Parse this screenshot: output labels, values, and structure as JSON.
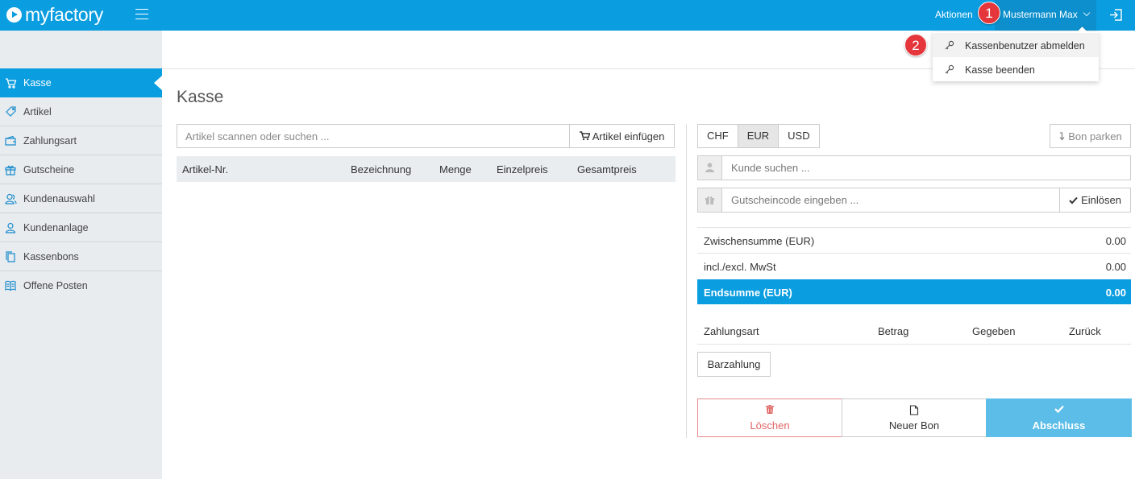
{
  "header": {
    "logo_text": "myfactory",
    "actions_label": "Aktionen",
    "user_name": "Mustermann Max"
  },
  "callouts": [
    "1",
    "2"
  ],
  "user_menu": {
    "items": [
      {
        "label": "Kassenbenutzer abmelden",
        "icon": "key-icon"
      },
      {
        "label": "Kasse beenden",
        "icon": "key-icon"
      }
    ]
  },
  "sidebar": {
    "items": [
      {
        "label": "Kasse",
        "icon": "cart-icon",
        "active": true
      },
      {
        "label": "Artikel",
        "icon": "tag-icon"
      },
      {
        "label": "Zahlungsart",
        "icon": "wallet-icon"
      },
      {
        "label": "Gutscheine",
        "icon": "gift-icon"
      },
      {
        "label": "Kundenauswahl",
        "icon": "users-icon"
      },
      {
        "label": "Kundenanlage",
        "icon": "user-icon"
      },
      {
        "label": "Kassenbons",
        "icon": "copy-icon"
      },
      {
        "label": "Offene Posten",
        "icon": "book-icon"
      }
    ]
  },
  "main": {
    "title": "Kasse",
    "search_placeholder": "Artikel scannen oder suchen ...",
    "insert_button": "Artikel einfügen",
    "columns": [
      "Artikel-Nr.",
      "Bezeichnung",
      "Menge",
      "Einzelpreis",
      "Gesamtpreis"
    ]
  },
  "cart": {
    "currencies": [
      "CHF",
      "EUR",
      "USD"
    ],
    "active_currency": "EUR",
    "park_button": "Bon parken",
    "customer_placeholder": "Kunde suchen ...",
    "voucher_placeholder": "Gutscheincode eingeben ...",
    "redeem_button": "Einlösen",
    "subtotal_label": "Zwischensumme (EUR)",
    "subtotal_value": "0.00",
    "tax_label": "incl./excl. MwSt",
    "tax_value": "0.00",
    "total_label": "Endsumme (EUR)",
    "total_value": "0.00",
    "payment_columns": [
      "Zahlungsart",
      "Betrag",
      "Gegeben",
      "Zurück"
    ],
    "cash_button": "Barzahlung",
    "delete_button": "Löschen",
    "new_button": "Neuer Bon",
    "finish_button": "Abschluss"
  },
  "colors": {
    "primary": "#0a9de0",
    "finish": "#5bbde8",
    "danger": "#e06666",
    "callout": "#e5363b"
  }
}
